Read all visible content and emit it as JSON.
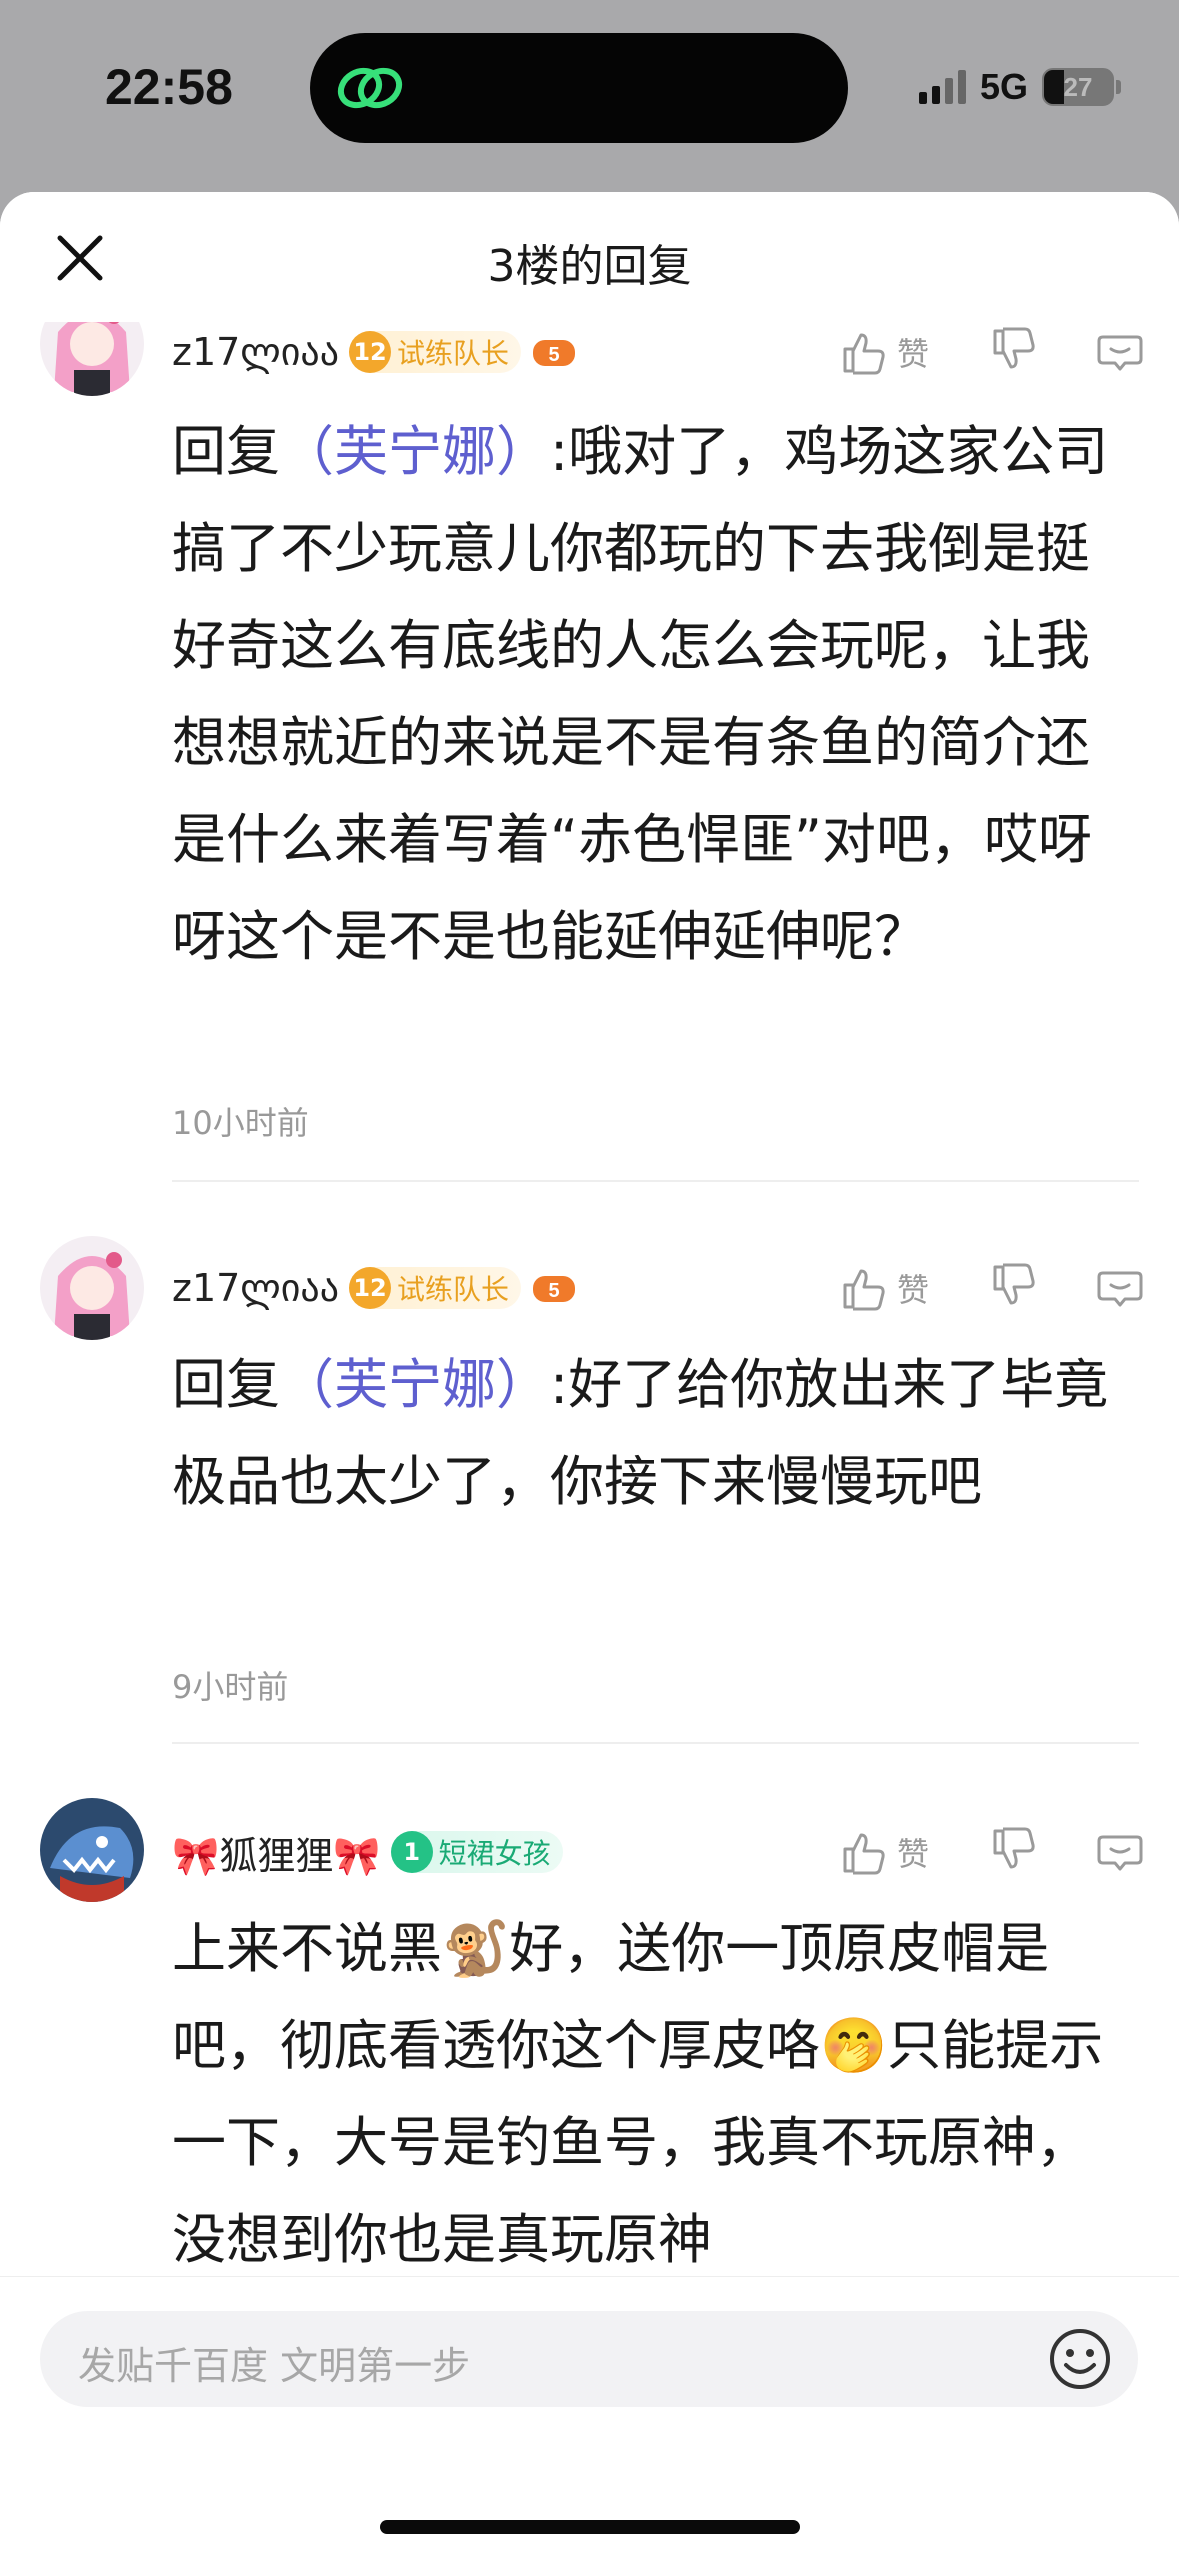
{
  "status_bar": {
    "time": "22:58",
    "network": "5G",
    "battery": "27",
    "battery_level_percent": 27
  },
  "header": {
    "title": "3楼的回复"
  },
  "comments": [
    {
      "username": "z17ლიაა",
      "badge": {
        "level": "12",
        "label": "试练队长"
      },
      "game_badge_num": "5",
      "like_label": "赞",
      "reply_prefix": "回复",
      "reply_to": "（芙宁娜）",
      "text": ":哦对了，鸡场这家公司搞了不少玩意儿你都玩的下去我倒是挺好奇这么有底线的人怎么会玩呢，让我想想就近的来说是不是有条鱼的简介还是什么来着写着“赤色悍匪”对吧，哎呀呀这个是不是也能延伸延伸呢？",
      "time": "10小时前"
    },
    {
      "username": "z17ლიაა",
      "badge": {
        "level": "12",
        "label": "试练队长"
      },
      "game_badge_num": "5",
      "like_label": "赞",
      "reply_prefix": "回复",
      "reply_to": "（芙宁娜）",
      "text": ":好了给你放出来了毕竟极品也太少了，你接下来慢慢玩吧",
      "time": "9小时前"
    },
    {
      "username": "狐狸狸",
      "bow_left": "🎀",
      "bow_right": "🎀",
      "badge": {
        "level": "1",
        "label": "短裙女孩"
      },
      "like_label": "赞",
      "text_part1": "上来不说黑",
      "emoji1": "🐒",
      "text_part2": "好，送你一顶原皮帽是吧，彻底看透你这个厚皮咯",
      "emoji2": "🤭",
      "text_part3": "只能提示一下，大号是钓鱼号，我真不玩原神，没想到你也是真玩原神"
    }
  ],
  "composer": {
    "placeholder": "发贴千百度 文明第一步"
  },
  "icons": {
    "close": "close-icon",
    "like": "thumbs-up-icon",
    "dislike": "thumbs-down-icon",
    "comment": "comment-bubble-icon",
    "emoji": "smiley-icon"
  },
  "colors": {
    "reply_name": "#5e5fcf",
    "badge_gold": "#f3a72b",
    "badge_green": "#24c286"
  }
}
